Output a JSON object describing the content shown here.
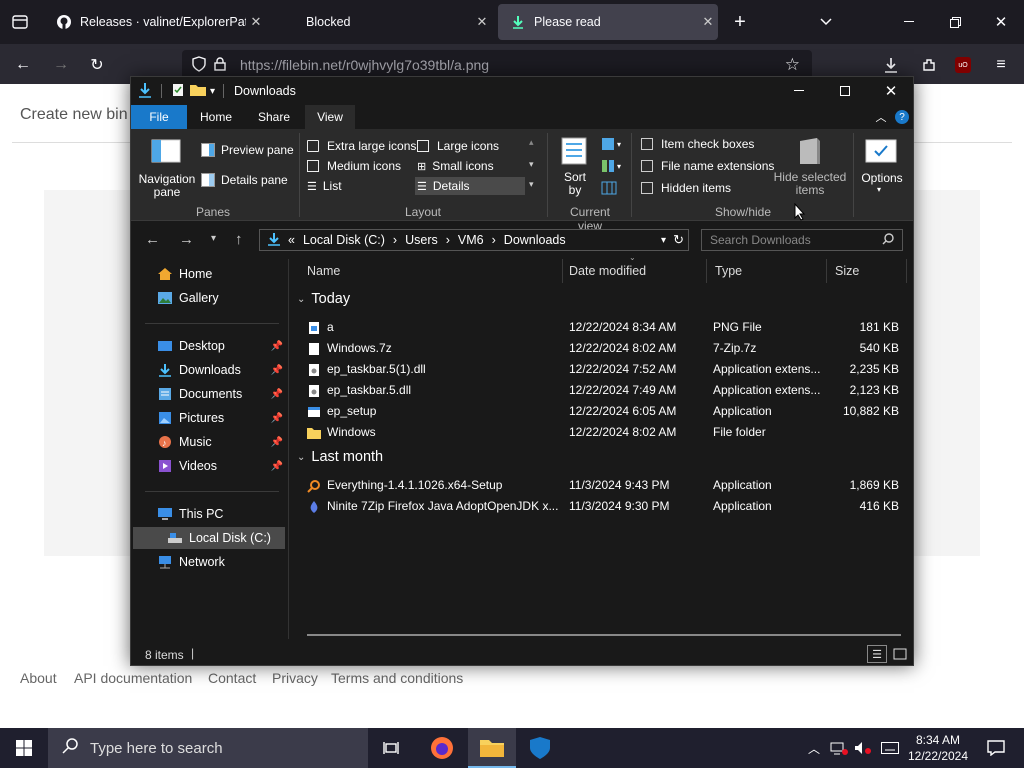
{
  "browser": {
    "tabs": [
      {
        "title": "Releases · valinet/ExplorerPatch",
        "icon": "github-icon"
      },
      {
        "title": "Blocked",
        "icon": "none"
      },
      {
        "title": "Please read",
        "icon": "download-icon"
      }
    ],
    "url": "https://filebin.net/r0wjhvylg7o39tbl/a.png",
    "extension_badge": "uO"
  },
  "webpage": {
    "title": "Create new bin",
    "footer_links": [
      "About",
      "API documentation",
      "Contact",
      "Privacy",
      "Terms and conditions"
    ]
  },
  "explorer": {
    "title": "Downloads",
    "ribbon_tabs": [
      "File",
      "Home",
      "Share",
      "View"
    ],
    "panes": {
      "navigation_pane": "Navigation\npane",
      "preview_pane": "Preview pane",
      "details_pane": "Details pane",
      "group": "Panes"
    },
    "layout": {
      "options": [
        "Extra large icons",
        "Large icons",
        "Medium icons",
        "Small icons",
        "List",
        "Details"
      ],
      "selected": "Details",
      "group": "Layout"
    },
    "current_view": {
      "sort_by": "Sort\nby",
      "group": "Current view"
    },
    "show_hide": {
      "item_check_boxes": "Item check boxes",
      "file_name_extensions": "File name extensions",
      "hidden_items": "Hidden items",
      "hide_selected": "Hide selected\nitems",
      "group": "Show/hide"
    },
    "options_label": "Options",
    "breadcrumb": [
      "Local Disk (C:)",
      "Users",
      "VM6",
      "Downloads"
    ],
    "breadcrumb_prefix": "«",
    "search_placeholder": "Search Downloads",
    "sidebar": [
      {
        "label": "Home",
        "icon": "home-icon"
      },
      {
        "label": "Gallery",
        "icon": "gallery-icon"
      },
      {
        "label": "Desktop",
        "icon": "desktop-icon",
        "pinned": true
      },
      {
        "label": "Downloads",
        "icon": "downloads-icon",
        "pinned": true
      },
      {
        "label": "Documents",
        "icon": "documents-icon",
        "pinned": true
      },
      {
        "label": "Pictures",
        "icon": "pictures-icon",
        "pinned": true
      },
      {
        "label": "Music",
        "icon": "music-icon",
        "pinned": true
      },
      {
        "label": "Videos",
        "icon": "videos-icon",
        "pinned": true
      },
      {
        "label": "This PC",
        "icon": "pc-icon"
      },
      {
        "label": "Local Disk (C:)",
        "icon": "drive-icon",
        "selected": true
      },
      {
        "label": "Network",
        "icon": "network-icon"
      }
    ],
    "columns": [
      "Name",
      "Date modified",
      "Type",
      "Size"
    ],
    "groups": [
      {
        "label": "Today",
        "files": [
          {
            "name": "a",
            "date": "12/22/2024 8:34 AM",
            "type": "PNG File",
            "size": "181 KB",
            "icon": "image-file-icon"
          },
          {
            "name": "Windows.7z",
            "date": "12/22/2024 8:02 AM",
            "type": "7-Zip.7z",
            "size": "540 KB",
            "icon": "blank-file-icon"
          },
          {
            "name": "ep_taskbar.5(1).dll",
            "date": "12/22/2024 7:52 AM",
            "type": "Application extens...",
            "size": "2,235 KB",
            "icon": "dll-file-icon"
          },
          {
            "name": "ep_taskbar.5.dll",
            "date": "12/22/2024 7:49 AM",
            "type": "Application extens...",
            "size": "2,123 KB",
            "icon": "dll-file-icon"
          },
          {
            "name": "ep_setup",
            "date": "12/22/2024 6:05 AM",
            "type": "Application",
            "size": "10,882 KB",
            "icon": "app-icon"
          },
          {
            "name": "Windows",
            "date": "12/22/2024 8:02 AM",
            "type": "File folder",
            "size": "",
            "icon": "folder-icon"
          }
        ]
      },
      {
        "label": "Last month",
        "files": [
          {
            "name": "Everything-1.4.1.1026.x64-Setup",
            "date": "11/3/2024 9:43 PM",
            "type": "Application",
            "size": "1,869 KB",
            "icon": "everything-icon"
          },
          {
            "name": "Ninite 7Zip Firefox Java AdoptOpenJDK x...",
            "date": "11/3/2024 9:30 PM",
            "type": "Application",
            "size": "416 KB",
            "icon": "ninite-icon"
          }
        ]
      }
    ],
    "status": "8 items"
  },
  "taskbar": {
    "search_placeholder": "Type here to search",
    "time": "8:34 AM",
    "date": "12/22/2024"
  }
}
